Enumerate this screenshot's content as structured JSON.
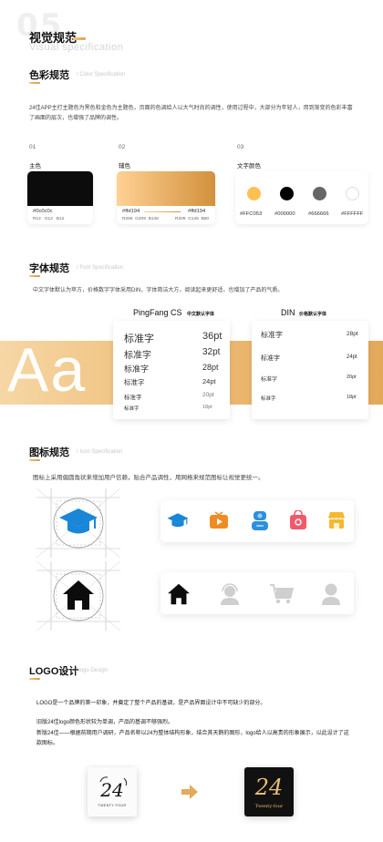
{
  "header": {
    "number": "05",
    "title": "视觉规范",
    "subtitle": "Visual specification"
  },
  "color_section": {
    "title": "色彩规范",
    "subtitle": "/ Color Specification",
    "description": "24佳APP主打主题色为黑色和金色为主题色，页面的色调给人以大气时尚的调性，使用过程中，大部分为年轻人，用到渐变的色彩丰富了画面的层次，也增强了品牌的调性。",
    "groups": [
      {
        "num": "01",
        "label": "主色",
        "hex": "#0c0c0c",
        "rgb": [
          "R12",
          "G12",
          "B12"
        ],
        "color": "#0c0c0c"
      },
      {
        "num": "02",
        "label": "辅色",
        "hex_start": "#ffd194",
        "rgb_start": [
          "R255",
          "G209",
          "B148"
        ],
        "hex_end": "#ffd194",
        "rgb_end": [
          "R209",
          "G145",
          "B60"
        ],
        "color_start": "#ffd194",
        "color_end": "#d1913c"
      },
      {
        "num": "03",
        "label": "文字颜色"
      }
    ],
    "text_colors": [
      {
        "hex": "#FFC053",
        "color": "#FFC053"
      },
      {
        "hex": "#000000",
        "color": "#000000"
      },
      {
        "hex": "#666666",
        "color": "#666666"
      },
      {
        "hex": "#FFFFFF",
        "color": "#FFFFFF"
      }
    ]
  },
  "font_section": {
    "title": "字体规范",
    "subtitle": "/ Font Specification",
    "description": "中文字体默认为苹方，价格数字字体采用DIN，字体简洁大方，阅读起来更舒适，也增加了产品的气质。",
    "big_sample": "Aa",
    "pingfang": {
      "name": "PingFang CS",
      "tag": "中文默认字体",
      "rows": [
        {
          "sample": "标准字",
          "size": "36pt"
        },
        {
          "sample": "标准字",
          "size": "32pt"
        },
        {
          "sample": "标准字",
          "size": "28pt"
        },
        {
          "sample": "标准字",
          "size": "24pt"
        },
        {
          "sample": "标准字",
          "size": "20pt"
        },
        {
          "sample": "标准字",
          "size": "18pt"
        }
      ]
    },
    "din": {
      "name": "DIN",
      "tag": "价格默认字体",
      "rows": [
        {
          "sample": "标准字",
          "size": "28pt"
        },
        {
          "sample": "标准字",
          "size": "24pt"
        },
        {
          "sample": "标准字",
          "size": "20pt"
        },
        {
          "sample": "标准字",
          "size": "18pt"
        }
      ]
    }
  },
  "icon_section": {
    "title": "图标规范",
    "subtitle": "/ Icon Specification",
    "description": "图标上采用偏圆角状来增加用户信赖，贴合产品调性，用网格来规范图标让视觉更统一。",
    "row1_icons": [
      "graduation-cap-icon",
      "tv-icon",
      "contacts-icon",
      "shopping-bag-icon",
      "shop-icon"
    ],
    "row2_icons": [
      "home-icon",
      "headset-user-icon",
      "cart-icon",
      "user-icon"
    ]
  },
  "logo_section": {
    "title": "LOGO设计",
    "subtitle": "/ logo Design",
    "para1": "LOGO是一个品牌的第一印象，并奠定了整个产品的基调，是产品界面设计中不可缺少的部分。",
    "para2": "旧版24佳logo颜色形状较为单调，产品的基调不够强烈。",
    "para3": "新版24佳——根据前期用户调研，产品名称以24为整体结构形象，结合其天鹅的图形，logo给人以高贵的形象展示，以此设计了这款图标。",
    "old_logo_text": "TWENTY·FOUR",
    "new_logo_text": "Twenty-four",
    "logo_numeral": "24"
  }
}
